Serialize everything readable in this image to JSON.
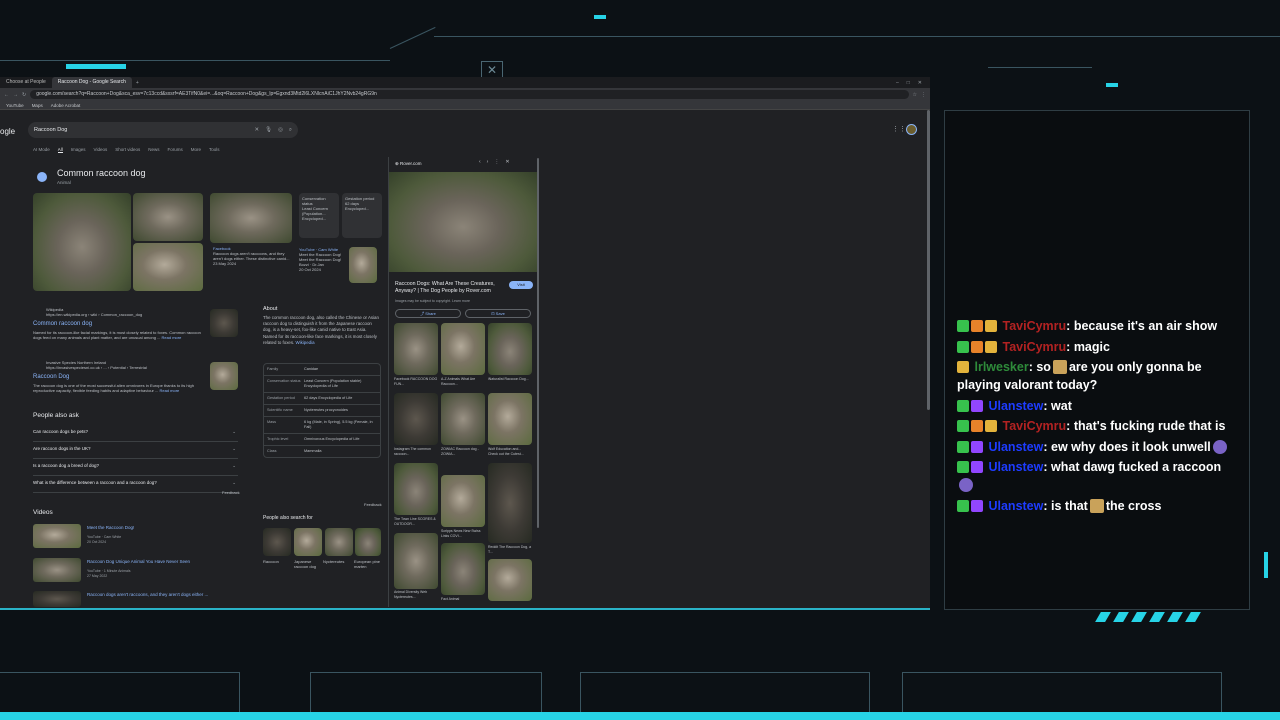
{
  "browser": {
    "tabs": [
      "Choose at People",
      "Raccoon Dog - Google Search"
    ],
    "url": "google.com/search?q=Raccoon+Dog&sca_esv=7c13ccd&sxsrf=AE3TifN0&ei=...&oq=Raccoon+Dog&gs_lp=Egxnd3Mtd2l6LXNlcnAiC1JhY2Nvb24gRG9n",
    "bookmarks": [
      "YouTube",
      "Maps",
      "Adobe Acrobat"
    ],
    "search_query": "Raccoon Dog",
    "filters": [
      "AI Mode",
      "All",
      "Images",
      "Videos",
      "Short videos",
      "News",
      "Forums",
      "More",
      "Tools"
    ]
  },
  "knowledge": {
    "title": "Common raccoon dog",
    "subtitle": "Animal",
    "fact_cards": [
      {
        "label": "Conservation status",
        "value": "Least Concern (Population...",
        "source": "Encycloped..."
      },
      {
        "label": "Gestation period",
        "value": "62 days",
        "source": "Encycloped..."
      }
    ],
    "facebook_snippet": {
      "source": "Facebook",
      "text": "Raccoon dogs aren't raccoons, and they aren't dogs either. These distinctive canid...",
      "date": "23 May 2024"
    },
    "youtube_snippet": {
      "source": "YouTube · Cam White",
      "text": "Meet the Raccoon Dog! Meet the Raccoon Dog! Bozzi · Dr.Jan",
      "date": "20 Oct 2024",
      "duration": "0:53"
    }
  },
  "results": [
    {
      "site": "Wikipedia",
      "url": "https://en.wikipedia.org › wiki › Common_raccoon_dog",
      "title": "Common raccoon dog",
      "snippet": "Named for its raccoon-like facial markings, it is most closely related to foxes. Common raccoon dogs feed on many animals and plant matter, and are unusual among ...",
      "more": "Read more"
    },
    {
      "site": "Invasive Species Northern Ireland",
      "url": "https://invasivespeciesni.co.uk › ... › Potential › Terrestrial",
      "title": "Raccoon Dog",
      "snippet": "The raccoon dog is one of the most successful alien omnivores in Europe thanks to its high reproductive capacity, flexible feeding habits and adaptive behaviour ...",
      "more": "Read more"
    }
  ],
  "paa": {
    "heading": "People also ask",
    "questions": [
      "Can raccoon dogs be pets?",
      "Are raccoon dogs in the UK?",
      "Is a raccoon dog a breed of dog?",
      "What is the difference between a raccoon and a raccoon dog?"
    ],
    "feedback": "Feedback"
  },
  "videos": {
    "heading": "Videos",
    "items": [
      {
        "title": "Meet the Raccoon Dog!",
        "meta": "YouTube · Cam White",
        "date": "20 Oct 2024",
        "duration": "0:53"
      },
      {
        "title": "Raccoon Dog Unique Animal You Have Never Seen",
        "meta": "YouTube · 1 Minute Animals",
        "date": "27 May 2022",
        "duration": "1:39"
      },
      {
        "title": "Raccoon dogs aren't raccoons, and they aren't dogs either ...",
        "meta": "",
        "date": "",
        "duration": ""
      }
    ]
  },
  "about": {
    "heading": "About",
    "text": "The common raccoon dog, also called the Chinese or Asian raccoon dog to distinguish it from the Japanese raccoon dog, is a heavy-set, fox-like canid native to East Asia. Named for its raccoon-like face markings, it is most closely related to foxes.",
    "source_link": "Wikipedia",
    "facts": [
      {
        "k": "Family",
        "v": "Canidae"
      },
      {
        "k": "Conservation status",
        "v": "Least Concern (Population stable) Encyclopedia of Life"
      },
      {
        "k": "Gestation period",
        "v": "62 days Encyclopedia of Life"
      },
      {
        "k": "Scientific name",
        "v": "Nyctereutes procyonoides"
      },
      {
        "k": "Mass",
        "v": "6 kg (Male, in Spring), 5.5 kg (Female, in Fall)"
      },
      {
        "k": "Trophic level",
        "v": "Omnivorous Encyclopedia of Life"
      },
      {
        "k": "Class",
        "v": "Mammalia"
      }
    ],
    "feedback": "Feedback"
  },
  "people_also_search": {
    "heading": "People also search for",
    "items": [
      "Raccoon",
      "Japanese raccoon dog",
      "Nyctereutes",
      "European pine marten"
    ]
  },
  "side_panel": {
    "source": "Rover.com",
    "title": "Raccoon Dogs: What Are These Creatures, Anyway? | The Dog People by Rover.com",
    "visit": "Visit",
    "note": "Images may be subject to copyright. Learn more",
    "share": "Share",
    "save": "Save",
    "grid_captions": [
      "Facebook RACCOON DOG FUN...",
      "A-Z Animals What Are Raccoon...",
      "iNaturalist Raccoon Dog...",
      "Instagram The common raccoon...",
      "ZOWIAC Raccoon dog - ZOWIA...",
      "Wolf Education and... Check out the Cutest...",
      "The Town Line SCORES & OUTDOOR...",
      "Scripps News New Swiss Links COVI...",
      "Reddit The Raccoon Dog, a T...",
      "Animal Diversity Web Nyctereutes...",
      "Fact Animal",
      ""
    ]
  },
  "chat": {
    "messages": [
      {
        "user": "TaviCymru",
        "color": "red",
        "badges": [
          "green",
          "fire",
          "gold"
        ],
        "text": "because it's an air show"
      },
      {
        "user": "TaviCymru",
        "color": "red",
        "badges": [
          "green",
          "fire",
          "gold"
        ],
        "text": "magic"
      },
      {
        "user": "lrlwesker",
        "color": "green",
        "badges": [
          "gold"
        ],
        "text_before": "so",
        "text": "are you only gonna be playing valorant today?"
      },
      {
        "user": "Ulanstew",
        "color": "blue",
        "badges": [
          "green",
          "sub"
        ],
        "text": "wat"
      },
      {
        "user": "TaviCymru",
        "color": "red",
        "badges": [
          "green",
          "fire",
          "gold"
        ],
        "text": "that's fucking rude that is"
      },
      {
        "user": "Ulanstew",
        "color": "blue",
        "badges": [
          "green",
          "sub"
        ],
        "text": "ew why does it look unwell"
      },
      {
        "user": "Ulanstew",
        "color": "blue",
        "badges": [
          "green",
          "sub"
        ],
        "text": "what dawg fucked a raccoon"
      },
      {
        "user": "Ulanstew",
        "color": "blue",
        "badges": [
          "green",
          "sub"
        ],
        "text_before": "is that",
        "text": "the cross"
      }
    ]
  },
  "colors": {
    "accent": "#27d3e6",
    "link": "#8ab4f8",
    "page_bg": "#202124"
  }
}
